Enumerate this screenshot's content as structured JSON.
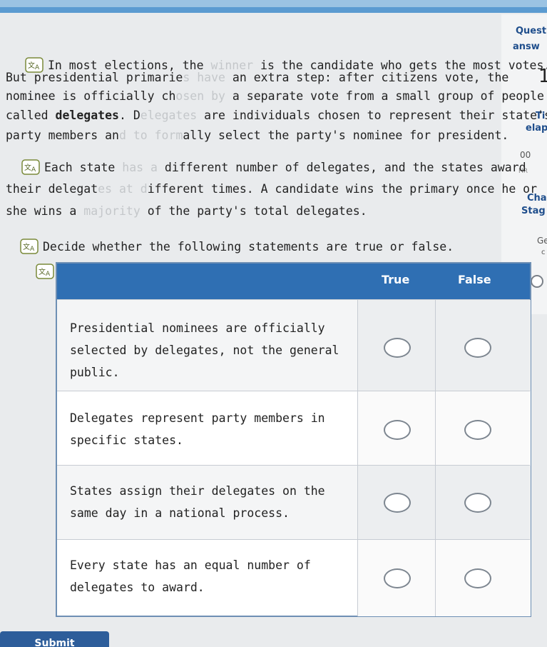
{
  "sidebar": {
    "question_label": "Quest",
    "answer_label": "answ",
    "number": "1",
    "timer_label": "Ti",
    "elapsed_label": "elap",
    "time_value": "00",
    "time_unit": "HR",
    "challenge_label": "Cha",
    "stage_label": "Stag",
    "get_label": "Ge",
    "small_label": "c"
  },
  "passage": {
    "p1": {
      "l1_a": "In most elections, the ",
      "l1_faded": "winner",
      "l1_b": " is the candidate who gets the most votes.",
      "l2_a": "But presidential primarie",
      "l2_faded": "s have",
      "l2_b": " an extra step: after citizens vote, the",
      "l3_a": "nominee is officially ch",
      "l3_faded": "osen by",
      "l3_b": " a separate vote from a small group of people",
      "l4_a": "called ",
      "l4_bold": "delegates",
      "l4_b": ". D",
      "l4_faded": "elegates",
      "l4_c": " are individuals chosen to represent their state's",
      "l5_a": "party members an",
      "l5_faded": "d to form",
      "l5_b": "ally select the party's nominee for president."
    },
    "p2": {
      "l1_a": "Each state ",
      "l1_faded": "has a ",
      "l1_b": "different number of delegates, and the states award",
      "l2_a": "their delegat",
      "l2_faded": "es at d",
      "l2_b": "ifferent times. A candidate wins the primary once he or",
      "l3_a": "she wins a ",
      "l3_faded": "majority",
      "l3_b": " of the party's total delegates."
    },
    "instruction": "Decide whether the following statements are true or false."
  },
  "table": {
    "col_true": "True",
    "col_false": "False",
    "rows": [
      {
        "lines": [
          "Presidential nominees are officially",
          "selected by delegates, not the general",
          "public."
        ]
      },
      {
        "lines": [
          "Delegates represent party members in",
          "specific states."
        ]
      },
      {
        "lines": [
          "States assign their delegates on the",
          "same day in a national process."
        ]
      },
      {
        "lines": [
          "Every state has an equal number of",
          "delegates to award."
        ]
      }
    ]
  },
  "submit_label": "Submit"
}
